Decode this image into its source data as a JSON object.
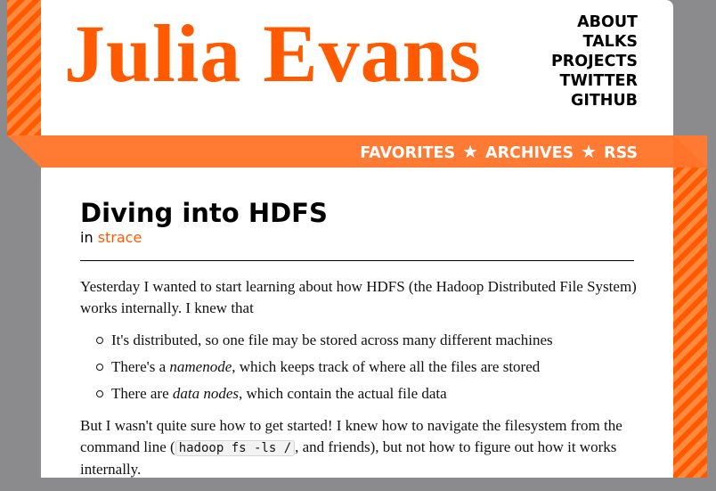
{
  "site": {
    "title": "Julia Evans"
  },
  "top_nav": [
    "ABOUT",
    "TALKS",
    "PROJECTS",
    "TWITTER",
    "GITHUB"
  ],
  "ribbon_nav": [
    "FAVORITES",
    "ARCHIVES",
    "RSS"
  ],
  "ribbon_separator": "★",
  "post": {
    "title": "Diving into HDFS",
    "category_prefix": "in",
    "category": "strace",
    "intro": "Yesterday I wanted to start learning about how HDFS (the Hadoop Distributed File System) works internally. I knew that",
    "bullets": [
      {
        "before": "It's distributed, so one file may be stored across many different machines",
        "em": "",
        "after": ""
      },
      {
        "before": "There's a ",
        "em": "namenode",
        "after": ", which keeps track of where all the files are stored"
      },
      {
        "before": "There are ",
        "em": "data nodes",
        "after": ", which contain the actual file data"
      }
    ],
    "para2_before": "But I wasn't quite sure how to get started! I knew how to navigate the filesystem from the command line (",
    "para2_code": "hadoop fs -ls /",
    "para2_after": ", and friends), but not how to figure out how it works internally."
  },
  "colors": {
    "accent": "#ff5a00",
    "ribbon": "#ff7a33",
    "background": "#8b8b8e"
  },
  "icons": {
    "separator": "star-icon",
    "bullet": "circle-bullet-icon"
  }
}
